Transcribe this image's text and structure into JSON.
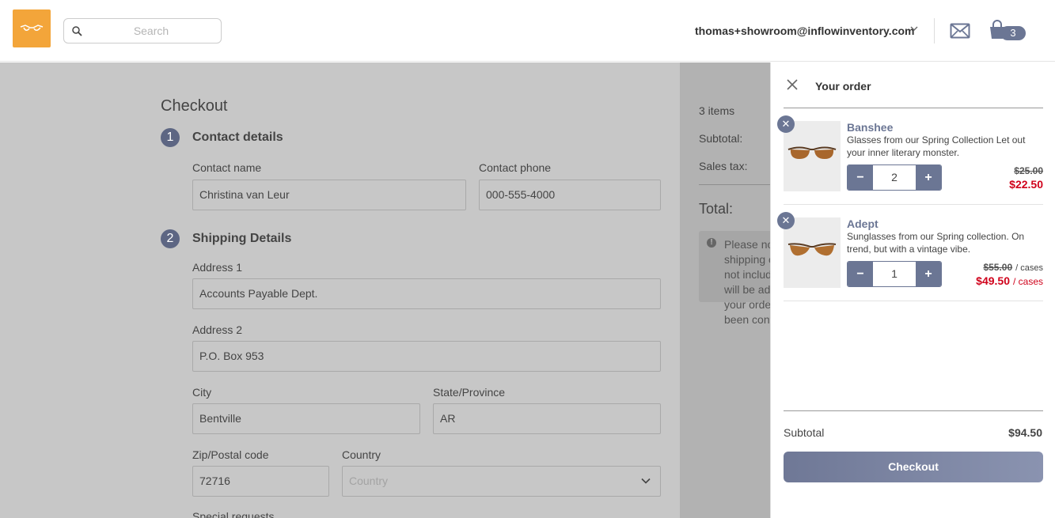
{
  "header": {
    "search_placeholder": "Search",
    "user_email": "thomas+showroom@inflowinventory.com",
    "cart_count": "3",
    "logo_color": "#f3a53a"
  },
  "checkout": {
    "title": "Checkout",
    "contact": {
      "step": "1",
      "title": "Contact details",
      "name_label": "Contact name",
      "name_value": "Christina van Leur",
      "phone_label": "Contact phone",
      "phone_value": "000-555-4000"
    },
    "shipping": {
      "step": "2",
      "title": "Shipping Details",
      "address1_label": "Address 1",
      "address1_value": "Accounts Payable Dept.",
      "address2_label": "Address 2",
      "address2_value": "P.O. Box 953",
      "city_label": "City",
      "city_value": "Bentville",
      "state_label": "State/Province",
      "state_value": "AR",
      "zip_label": "Zip/Postal code",
      "zip_value": "72716",
      "country_label": "Country",
      "country_placeholder": "Country",
      "special_label": "Special requests"
    }
  },
  "summary": {
    "items_count": "3 items",
    "subtotal_label": "Subtotal:",
    "tax_label": "Sales tax:",
    "total_label": "Total:",
    "notice_text": "Please note that shipping costs are not included and will be added once your order has been confirmed"
  },
  "drawer": {
    "title": "Your order",
    "items": [
      {
        "name": "Banshee",
        "description": "Glasses from our Spring Collection Let out your inner literary monster.",
        "quantity": "2",
        "old_price": "$25.00",
        "new_price": "$22.50",
        "unit": ""
      },
      {
        "name": "Adept",
        "description": "Sunglasses from our Spring collection. On trend, but with a vintage vibe.",
        "quantity": "1",
        "old_price": "$55.00",
        "new_price": "$49.50",
        "unit": "/ cases"
      }
    ],
    "subtotal_label": "Subtotal",
    "subtotal_value": "$94.50",
    "checkout_label": "Checkout"
  },
  "colors": {
    "accent": "#6b7694",
    "sale_price": "#d0021b",
    "overlay": "#c7c7c7"
  }
}
